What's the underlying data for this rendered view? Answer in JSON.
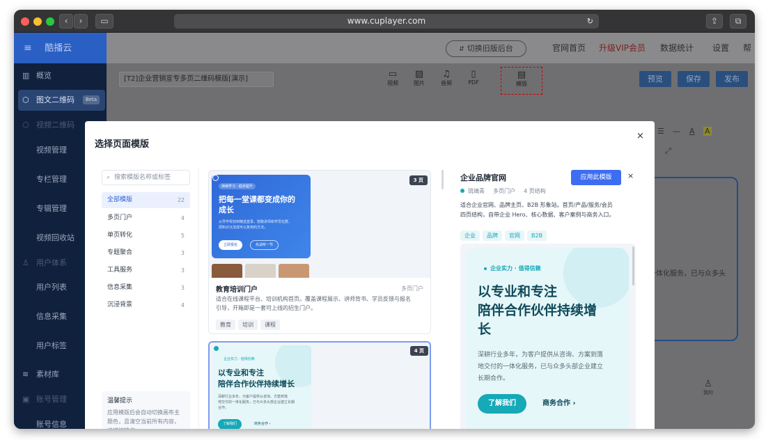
{
  "browser": {
    "url": "www.cuplayer.com"
  },
  "app": {
    "logo": "酷播云",
    "menu_icon": "hamburger-icon"
  },
  "sidebar": {
    "items": [
      {
        "label": "概览",
        "icon": "bar-chart-icon"
      },
      {
        "label": "图文二维码",
        "badge": "Beta",
        "icon": "cube-icon"
      },
      {
        "label": "视频二维码",
        "icon": "cube-icon"
      },
      {
        "label": "视频管理"
      },
      {
        "label": "专栏管理"
      },
      {
        "label": "专辑管理"
      },
      {
        "label": "视频回收站"
      },
      {
        "label": "用户体系",
        "icon": "user-icon"
      },
      {
        "label": "用户列表"
      },
      {
        "label": "信息采集"
      },
      {
        "label": "用户标签"
      },
      {
        "label": "素材库",
        "icon": "layers-icon"
      },
      {
        "label": "账号管理",
        "icon": "id-card-icon"
      },
      {
        "label": "账号信息"
      }
    ]
  },
  "header": {
    "switch_label": "切换旧版后台",
    "links": [
      "官网首页",
      "升级VIP会员",
      "数据统计",
      "设置",
      "帮助"
    ],
    "vip_color": "#c0322b"
  },
  "toolbar": {
    "doc_title": "[T2]企业营销宣专多页二维码模版[演示]",
    "tools": [
      "视频",
      "图片",
      "音频",
      "PDF",
      "模版"
    ],
    "buttons": {
      "preview": "预览",
      "save": "保存",
      "publish": "发布"
    }
  },
  "background_peek": {
    "text": "户提供从咨询、方案到落地交付的一体化服务，已与众多头",
    "nav_label": "我的"
  },
  "modal": {
    "title": "选择页面模版",
    "search_placeholder": "搜索模版名称或标签",
    "categories": [
      {
        "label": "全部模版",
        "count": "22"
      },
      {
        "label": "多页门户",
        "count": "4"
      },
      {
        "label": "单页转化",
        "count": "5"
      },
      {
        "label": "专题聚合",
        "count": "3"
      },
      {
        "label": "工具服务",
        "count": "3"
      },
      {
        "label": "信息采集",
        "count": "3"
      },
      {
        "label": "沉浸背景",
        "count": "4"
      }
    ],
    "tip": {
      "title": "温馨提示",
      "text": "应用模版后会自动切换画布主题色，且清空当前所有内容，请谨慎操作。"
    },
    "templates": [
      {
        "pages": "3 页",
        "eyebrow": "持续学习 · 稳步提升",
        "headline_1": "把每一堂课都变成你的",
        "headline_2": "成长",
        "sub_1": "从导学规划到精选直录，陪跑讲师和学员社群，",
        "sub_2": "把知识沉淀成可以复用的方法。",
        "btn_primary": "立即报名",
        "btn_secondary": "先试听一节",
        "name": "教育培训门户",
        "category": "多页门户",
        "desc_1": "适合在线课程平台、培训机构首页。覆盖课程展示、讲师背书、学员反馈与报名",
        "desc_2": "引导，开箱即是一套可上线的招生门户。",
        "tags": [
          "教育",
          "培训",
          "课程"
        ]
      },
      {
        "pages": "4 页",
        "eyebrow": "企业实力 · 值得信赖",
        "headline_1": "以专业和专注",
        "headline_2": "陪伴合作伙伴持续增长",
        "sub_1": "深耕行业多年，为客户提供从咨询、方案到落",
        "sub_2": "地交付的一体化服务，已与众多头部企业建立长期",
        "sub_3": "合作。",
        "btn_primary": "了解我们",
        "btn_secondary": "商务合作 ›"
      }
    ],
    "detail": {
      "name": "企业品牌官网",
      "apply_label": "应用此模版",
      "theme": "琉璃青",
      "category": "多页门户",
      "structure": "4 页结构",
      "desc_1": "适合企业官网、品牌主页、B2B 形象站。首页/产品/服务/会员",
      "desc_2": "四页结构，自带企业 Hero、核心数据、客户案例与商务入口。",
      "tags": [
        "企业",
        "品牌",
        "官网",
        "B2B"
      ],
      "preview": {
        "eyebrow": "企业实力 · 值得信赖",
        "headline_1": "以专业和专注",
        "headline_2": "陪伴合作伙伴持续增",
        "headline_3": "长",
        "sub_1": "深耕行业多年，为客户提供从咨询、方案到落",
        "sub_2": "地交付的一体化服务，已与众多头部企业建立",
        "sub_3": "长期合作。",
        "btn_primary": "了解我们",
        "btn_secondary": "商务合作 ›"
      }
    }
  },
  "colors": {
    "accent": "#3d6df0",
    "teal": "#16a9b8",
    "dark_teal": "#0f4a5a"
  }
}
